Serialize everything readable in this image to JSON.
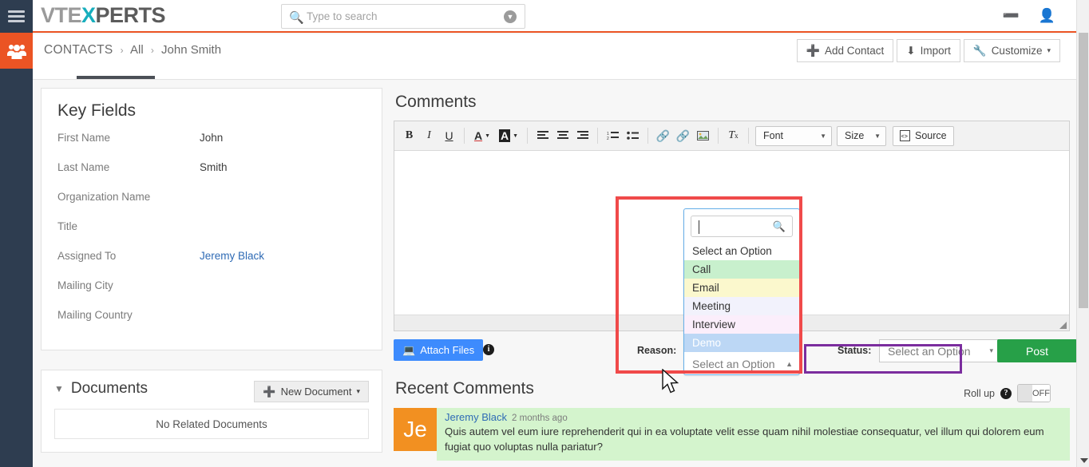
{
  "app": {
    "brand_left": "VTE",
    "brand_x": "X",
    "brand_right": "PERTS"
  },
  "search": {
    "placeholder": "Type to search",
    "value": "",
    "icon": "search-icon"
  },
  "topbar": {
    "add_icon": "plus-circle-icon",
    "user_icon": "user-icon",
    "menu_icon": "hamburger-menu-icon"
  },
  "breadcrumb": {
    "module": "CONTACTS",
    "sep": "›",
    "view": "All",
    "record": "John Smith"
  },
  "record_actions": {
    "add": "Add Contact",
    "add_icon": "plus-icon",
    "import": "Import",
    "import_icon": "import-icon",
    "customize": "Customize",
    "customize_icon": "wrench-icon",
    "customize_caret": "▾"
  },
  "key_fields": {
    "title": "Key Fields",
    "rows": [
      {
        "label": "First Name",
        "value": "John",
        "link": false
      },
      {
        "label": "Last Name",
        "value": "Smith",
        "link": false
      },
      {
        "label": "Organization Name",
        "value": "",
        "link": false
      },
      {
        "label": "Title",
        "value": "",
        "link": false
      },
      {
        "label": "Assigned To",
        "value": "Jeremy Black",
        "link": true
      },
      {
        "label": "Mailing City",
        "value": "",
        "link": false
      },
      {
        "label": "Mailing Country",
        "value": "",
        "link": false
      }
    ]
  },
  "documents": {
    "title": "Documents",
    "collapse_icon": "chevron-down-icon",
    "new_button": "New Document",
    "new_button_icon": "plus-icon",
    "new_button_caret": "▾",
    "empty_text": "No Related Documents"
  },
  "comments": {
    "title": "Comments",
    "toolbar": {
      "bold": "B",
      "italic": "I",
      "underline": "U",
      "text_color": "A",
      "bg_color": "A",
      "align_left": "align-left-icon",
      "align_center": "align-center-icon",
      "align_right": "align-right-icon",
      "numbered_list": "numbered-list-icon",
      "bulleted_list": "bulleted-list-icon",
      "link": "link-icon",
      "unlink": "unlink-icon",
      "image": "image-icon",
      "remove_format": "remove-format-icon",
      "font_label": "Font",
      "size_label": "Size",
      "source_label": "Source",
      "caret": "▾"
    },
    "body_value": "",
    "attach_label": "Attach Files",
    "attach_icon": "attach-icon",
    "info_icon": "info-icon",
    "info_glyph": "i",
    "reason_label": "Reason:",
    "status_label": "Status:",
    "post_label": "Post"
  },
  "reason_dropdown": {
    "open": true,
    "search_value": "",
    "search_icon": "search-icon",
    "selected_label": "Select an Option",
    "collapse_caret": "▲",
    "options": [
      {
        "label": "Select an Option",
        "color": "#ffffff"
      },
      {
        "label": "Call",
        "color": "#c8f0cd"
      },
      {
        "label": "Email",
        "color": "#fbf8cd"
      },
      {
        "label": "Meeting",
        "color": "#f2f2fc"
      },
      {
        "label": "Interview",
        "color": "#fbeefb"
      },
      {
        "label": "Demo",
        "color": "#bcd7f5"
      }
    ]
  },
  "status_dropdown": {
    "selected_label": "Select an Option",
    "caret": "▾"
  },
  "recent_comments": {
    "title": "Recent Comments",
    "rollup_label": "Roll up",
    "rollup_help_icon": "help-icon",
    "rollup_help_glyph": "?",
    "toggle_state": "OFF",
    "items": [
      {
        "initials": "Je",
        "author": "Jeremy Black",
        "time": "2 months ago",
        "text": "Quis autem vel eum iure reprehenderit qui in ea voluptate velit esse quam nihil molestiae consequatur, vel illum qui dolorem eum fugiat quo voluptas nulla pariatur?"
      }
    ]
  },
  "colors": {
    "brand_orange": "#eb5424",
    "rail_dark": "#2e3d50",
    "accent_teal": "#17aebd",
    "post_green": "#27a048",
    "attach_blue": "#3d8bfd",
    "highlight_red": "#f04a4a",
    "highlight_purple": "#7b2d9e",
    "comment_green": "#d4f4cd",
    "avatar_orange": "#f29021"
  }
}
